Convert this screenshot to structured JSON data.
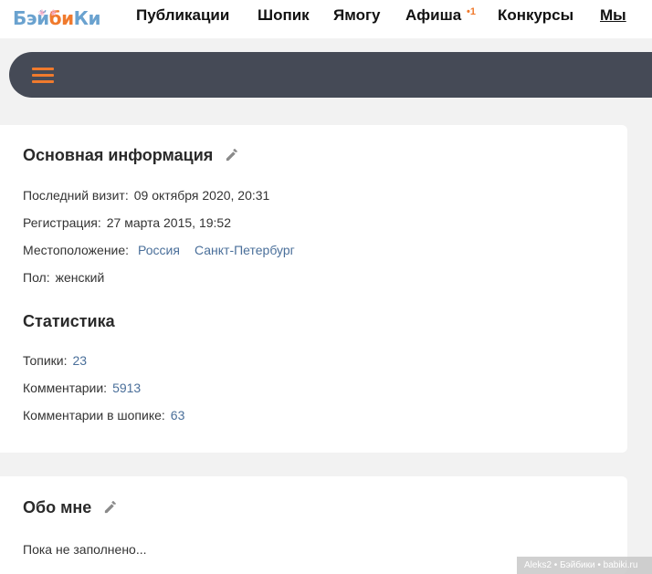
{
  "header": {
    "logo": {
      "part1": "Бэй",
      "part2": "би",
      "part3": "Ки"
    },
    "nav": [
      {
        "label": "Публикации"
      },
      {
        "label": "Шопик"
      },
      {
        "label": "Ямогу"
      },
      {
        "label": "Афиша",
        "badge": "•1"
      },
      {
        "label": "Конкурсы"
      },
      {
        "label": "Мы"
      }
    ]
  },
  "colors": {
    "accent": "#f07a2d",
    "bar": "#454a56",
    "link": "#4a6f9a",
    "logo_blue": "#6aa2cf"
  },
  "icons": {
    "menu": "hamburger-icon",
    "edit": "pencil-icon"
  },
  "basic_info": {
    "title": "Основная информация",
    "last_visit_label": "Последний визит:",
    "last_visit_value": "09 октября 2020, 20:31",
    "registration_label": "Регистрация:",
    "registration_value": "27 марта 2015, 19:52",
    "location_label": "Местоположение:",
    "location_country": "Россия",
    "location_city": "Санкт-Петербург",
    "gender_label": "Пол:",
    "gender_value": "женский"
  },
  "stats": {
    "title": "Статистика",
    "topics_label": "Топики:",
    "topics_value": "23",
    "comments_label": "Комментарии:",
    "comments_value": "5913",
    "shop_comments_label": "Комментарии в шопике:",
    "shop_comments_value": "63"
  },
  "about": {
    "title": "Обо мне",
    "text": "Пока не заполнено..."
  },
  "watermark": "Aleks2 • Бэйбики • babiki.ru"
}
